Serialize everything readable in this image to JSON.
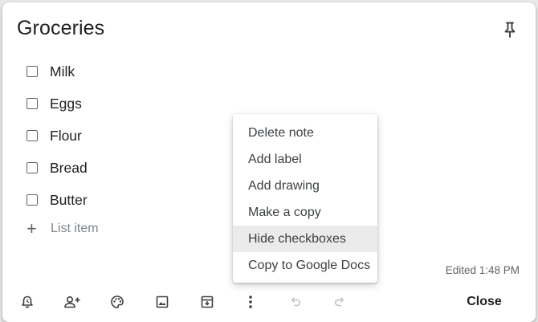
{
  "note": {
    "title": "Groceries",
    "pin_icon": "pin-icon",
    "items": [
      {
        "text": "Milk",
        "checked": false
      },
      {
        "text": "Eggs",
        "checked": false
      },
      {
        "text": "Flour",
        "checked": false
      },
      {
        "text": "Bread",
        "checked": false
      },
      {
        "text": "Butter",
        "checked": false
      }
    ],
    "add_item_placeholder": "List item",
    "edited": "Edited 1:48 PM"
  },
  "toolbar": {
    "icons": [
      "remind-me-icon",
      "collaborator-icon",
      "background-options-icon",
      "add-image-icon",
      "archive-icon",
      "more-icon",
      "undo-icon",
      "redo-icon"
    ],
    "close_label": "Close"
  },
  "menu": {
    "items": [
      {
        "label": "Delete note"
      },
      {
        "label": "Add label"
      },
      {
        "label": "Add drawing"
      },
      {
        "label": "Make a copy"
      },
      {
        "label": "Hide checkboxes",
        "hovered": true
      },
      {
        "label": "Copy to Google Docs"
      }
    ]
  }
}
